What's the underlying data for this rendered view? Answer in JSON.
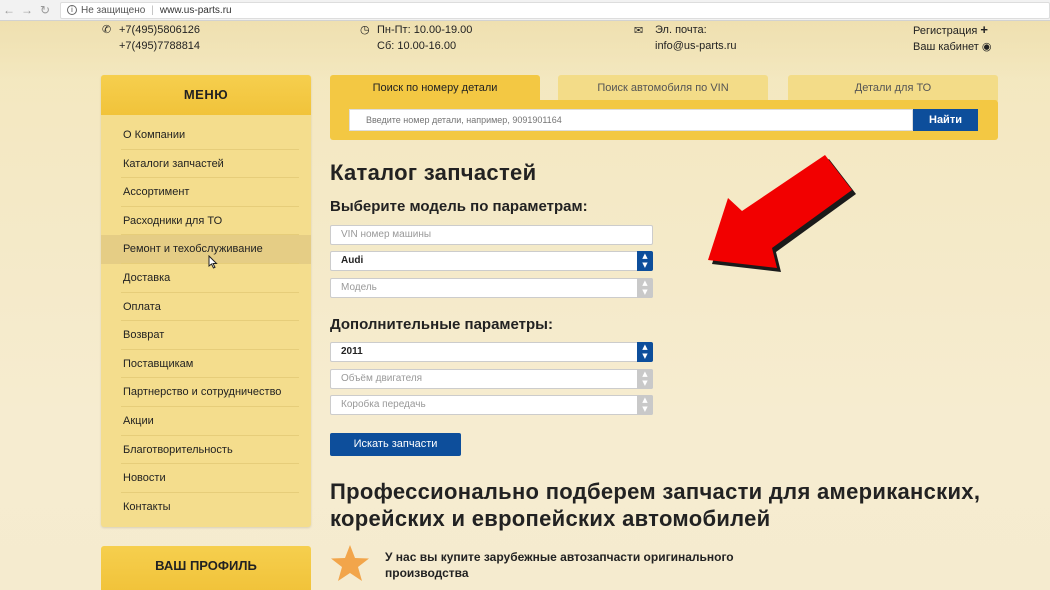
{
  "browser": {
    "secure_label": "Не защищено",
    "url": "www.us-parts.ru"
  },
  "header": {
    "phone1": "+7(495)5806126",
    "phone2": "+7(495)7788814",
    "hours1": "Пн-Пт: 10.00-19.00",
    "hours2": "Сб: 10.00-16.00",
    "email_label": "Эл. почта:",
    "email": "info@us-parts.ru",
    "register": "Регистрация",
    "cabinet": "Ваш кабинет"
  },
  "menu": {
    "title": "МЕНЮ",
    "items": [
      {
        "label": "О Компании"
      },
      {
        "label": "Каталоги запчастей"
      },
      {
        "label": "Ассортимент"
      },
      {
        "label": "Расходники для ТО"
      },
      {
        "label": "Ремонт и техобслуживание",
        "active": true
      },
      {
        "label": "Доставка"
      },
      {
        "label": "Оплата"
      },
      {
        "label": "Возврат"
      },
      {
        "label": "Поставщикам"
      },
      {
        "label": "Партнерство  и сотрудничество"
      },
      {
        "label": "Акции"
      },
      {
        "label": "Благотворительность"
      },
      {
        "label": "Новости"
      },
      {
        "label": "Контакты"
      }
    ]
  },
  "profile": {
    "title": "ВАШ ПРОФИЛЬ"
  },
  "tabs": [
    {
      "label": "Поиск по номеру детали",
      "active": true
    },
    {
      "label": "Поиск автомобиля по VIN"
    },
    {
      "label": "Детали для ТО"
    }
  ],
  "search": {
    "placeholder": "Введите номер детали, например, 9091901164",
    "button": "Найти"
  },
  "catalog": {
    "title": "Каталог запчастей",
    "subtitle": "Выберите модель по параметрам:",
    "vin_placeholder": "VIN номер машины",
    "make_value": "Audi",
    "model_placeholder": "Модель",
    "extra_title": "Дополнительные параметры:",
    "year_value": "2011",
    "engine_placeholder": "Объём двигателя",
    "gearbox_placeholder": "Коробка передачь",
    "find_button": "Искать запчасти"
  },
  "promo": {
    "heading": "Профессионально подберем запчасти для американских, корейских и европейских автомобилей",
    "feature": "У нас вы купите зарубежные автозапчасти оригинального производства"
  },
  "colors": {
    "accent_yellow": "#f3c843",
    "button_blue": "#0d4e9b",
    "arrow_red": "#ff0000"
  }
}
